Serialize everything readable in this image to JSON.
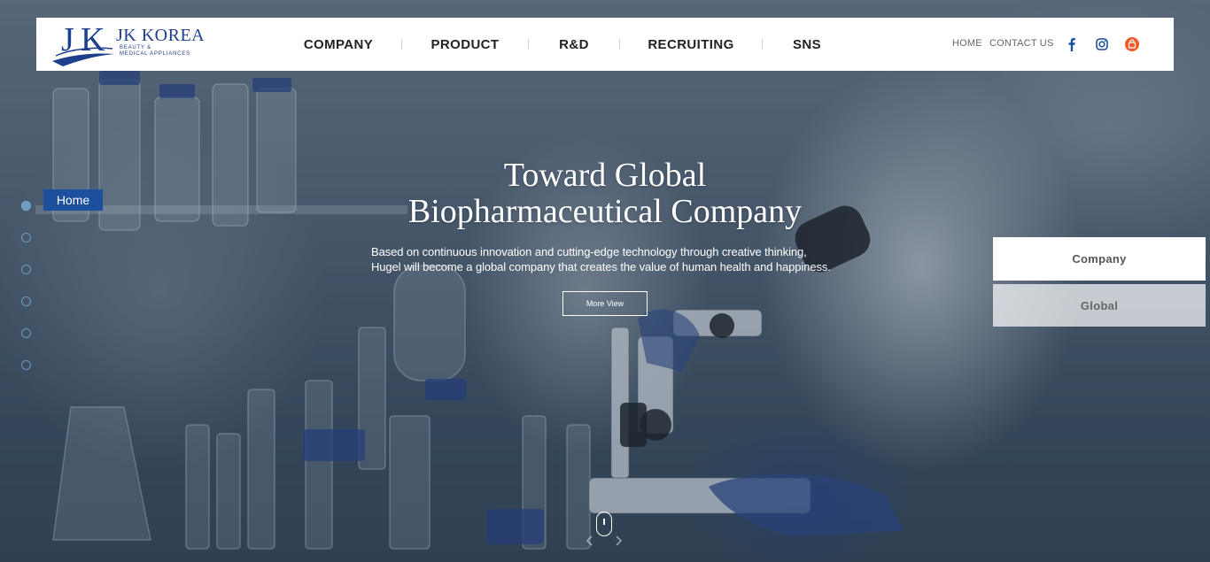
{
  "brand": {
    "name": "JK KOREA",
    "sub_line1": "BEAUTY &",
    "sub_line2": "MEDICAL APPLIANCES",
    "color": "#1e3f8a"
  },
  "nav": {
    "items": [
      {
        "label": "COMPANY"
      },
      {
        "label": "PRODUCT"
      },
      {
        "label": "R&D"
      },
      {
        "label": "RECRUITING"
      },
      {
        "label": "SNS"
      }
    ]
  },
  "utility": {
    "home": "HOME",
    "contact": "CONTACT US",
    "icons": [
      "facebook-icon",
      "instagram-icon",
      "shop-icon"
    ]
  },
  "hero": {
    "title_line1": "Toward Global",
    "title_line2": "Biopharmaceutical Company",
    "desc_line1": "Based on continuous innovation and cutting-edge technology through creative thinking,",
    "desc_line2": "Hugel will become a global company that creates the value of human health and happiness.",
    "button": "More View"
  },
  "sidebar": {
    "home_label": "Home",
    "dot_count": 6,
    "active_dot": 1,
    "accent": "#1c4f9c"
  },
  "side_buttons": {
    "company": "Company",
    "global": "Global"
  }
}
